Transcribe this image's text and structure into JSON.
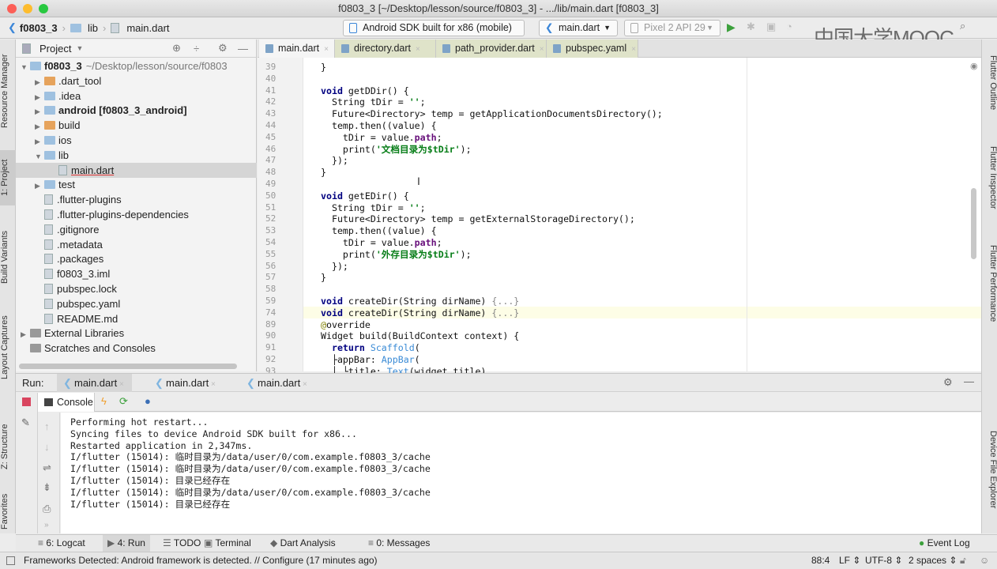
{
  "window": {
    "title": "f0803_3 [~/Desktop/lesson/source/f0803_3] - .../lib/main.dart [f0803_3]"
  },
  "breadcrumb": [
    "f0803_3",
    "lib",
    "main.dart"
  ],
  "toolbar": {
    "device": "Android SDK built for x86 (mobile)",
    "run_config": "main.dart",
    "emulator": "Pixel 2 API 29"
  },
  "watermark": "中国大学MOOC",
  "left_strip": [
    "Resource Manager",
    "1: Project",
    "Build Variants",
    "Layout Captures",
    "Z: Structure",
    "Favorites"
  ],
  "right_strip": [
    "Flutter Outline",
    "Flutter Inspector",
    "Flutter Performance",
    "Device File Explorer"
  ],
  "project": {
    "title": "Project",
    "tree": [
      {
        "label": "f0803_3",
        "suffix": "~/Desktop/lesson/source/f0803",
        "indent": 0,
        "type": "folder",
        "expanded": true,
        "bold": true
      },
      {
        "label": ".dart_tool",
        "indent": 1,
        "type": "folder-orange",
        "expanded": false
      },
      {
        "label": ".idea",
        "indent": 1,
        "type": "folder",
        "expanded": false
      },
      {
        "label": "android [f0803_3_android]",
        "indent": 1,
        "type": "folder",
        "expanded": false,
        "bold": true
      },
      {
        "label": "build",
        "indent": 1,
        "type": "folder-orange",
        "expanded": false
      },
      {
        "label": "ios",
        "indent": 1,
        "type": "folder",
        "expanded": false
      },
      {
        "label": "lib",
        "indent": 1,
        "type": "folder",
        "expanded": true
      },
      {
        "label": "main.dart",
        "indent": 2,
        "type": "file",
        "selected": true
      },
      {
        "label": "test",
        "indent": 1,
        "type": "folder",
        "expanded": false
      },
      {
        "label": ".flutter-plugins",
        "indent": 1,
        "type": "file"
      },
      {
        "label": ".flutter-plugins-dependencies",
        "indent": 1,
        "type": "file"
      },
      {
        "label": ".gitignore",
        "indent": 1,
        "type": "file"
      },
      {
        "label": ".metadata",
        "indent": 1,
        "type": "file"
      },
      {
        "label": ".packages",
        "indent": 1,
        "type": "file"
      },
      {
        "label": "f0803_3.iml",
        "indent": 1,
        "type": "file"
      },
      {
        "label": "pubspec.lock",
        "indent": 1,
        "type": "file"
      },
      {
        "label": "pubspec.yaml",
        "indent": 1,
        "type": "file"
      },
      {
        "label": "README.md",
        "indent": 1,
        "type": "file"
      },
      {
        "label": "External Libraries",
        "indent": 0,
        "type": "lib",
        "expanded": false
      },
      {
        "label": "Scratches and Consoles",
        "indent": 0,
        "type": "scratch"
      }
    ]
  },
  "editor": {
    "tabs": [
      {
        "label": "main.dart",
        "active": true
      },
      {
        "label": "directory.dart"
      },
      {
        "label": "path_provider.dart"
      },
      {
        "label": "pubspec.yaml"
      }
    ],
    "lines": [
      {
        "n": "39",
        "seg": [
          [
            "}",
            ""
          ]
        ]
      },
      {
        "n": "40",
        "seg": []
      },
      {
        "n": "41",
        "seg": [
          [
            "void",
            "kw"
          ],
          [
            " getDDir() {",
            ""
          ]
        ]
      },
      {
        "n": "42",
        "seg": [
          [
            "  String tDir = ",
            ""
          ],
          [
            "''",
            "str"
          ],
          [
            ";",
            ""
          ]
        ]
      },
      {
        "n": "43",
        "seg": [
          [
            "  Future<Directory> temp = getApplicationDocumentsDirectory();",
            ""
          ]
        ]
      },
      {
        "n": "44",
        "seg": [
          [
            "  temp.then((value) {",
            ""
          ]
        ]
      },
      {
        "n": "45",
        "seg": [
          [
            "    tDir = value.",
            ""
          ],
          [
            "path",
            "fld"
          ],
          [
            ";",
            ""
          ]
        ]
      },
      {
        "n": "46",
        "seg": [
          [
            "    print(",
            ""
          ],
          [
            "'文档目录为$tDir'",
            "str"
          ],
          [
            ");",
            ""
          ]
        ]
      },
      {
        "n": "47",
        "seg": [
          [
            "  });",
            ""
          ]
        ]
      },
      {
        "n": "48",
        "seg": [
          [
            "}",
            ""
          ]
        ]
      },
      {
        "n": "49",
        "seg": []
      },
      {
        "n": "50",
        "seg": [
          [
            "void",
            "kw"
          ],
          [
            " getEDir() {",
            ""
          ]
        ]
      },
      {
        "n": "51",
        "seg": [
          [
            "  String tDir = ",
            ""
          ],
          [
            "''",
            "str"
          ],
          [
            ";",
            ""
          ]
        ]
      },
      {
        "n": "52",
        "seg": [
          [
            "  Future<Directory> temp = getExternalStorageDirectory();",
            ""
          ]
        ]
      },
      {
        "n": "53",
        "seg": [
          [
            "  temp.then((value) {",
            ""
          ]
        ]
      },
      {
        "n": "54",
        "seg": [
          [
            "    tDir = value.",
            ""
          ],
          [
            "path",
            "fld"
          ],
          [
            ";",
            ""
          ]
        ]
      },
      {
        "n": "55",
        "seg": [
          [
            "    print(",
            ""
          ],
          [
            "'外存目录为$tDir'",
            "str"
          ],
          [
            ");",
            ""
          ]
        ]
      },
      {
        "n": "56",
        "seg": [
          [
            "  });",
            ""
          ]
        ]
      },
      {
        "n": "57",
        "seg": [
          [
            "}",
            ""
          ]
        ]
      },
      {
        "n": "58",
        "seg": []
      },
      {
        "n": "59",
        "seg": [
          [
            "void",
            "kw"
          ],
          [
            " createDir(String dirName) ",
            ""
          ],
          [
            "{...}",
            "fold"
          ]
        ]
      },
      {
        "n": "74",
        "seg": [
          [
            "void",
            "kw"
          ],
          [
            " createDir(String dirName) ",
            ""
          ],
          [
            "{...}",
            "fold"
          ]
        ]
      },
      {
        "n": "89",
        "seg": [
          [
            "@",
            "ann"
          ],
          [
            "override",
            ""
          ]
        ]
      },
      {
        "n": "90",
        "seg": [
          [
            "Widget build(BuildContext context) {",
            ""
          ]
        ]
      },
      {
        "n": "91",
        "seg": [
          [
            "  ",
            ""
          ],
          [
            "return",
            "kw"
          ],
          [
            " ",
            ""
          ],
          [
            "Scaffold",
            "cls"
          ],
          [
            "(",
            ""
          ]
        ]
      },
      {
        "n": "92",
        "seg": [
          [
            "  ├appBar: ",
            ""
          ],
          [
            "AppBar",
            "cls"
          ],
          [
            "(",
            ""
          ]
        ]
      },
      {
        "n": "93",
        "seg": [
          [
            "  │ └title: ",
            ""
          ],
          [
            "Text",
            "cls"
          ],
          [
            "(widget.title),",
            ""
          ]
        ]
      }
    ]
  },
  "run": {
    "label": "Run:",
    "tabs": [
      "main.dart",
      "main.dart",
      "main.dart"
    ],
    "console_tab": "Console",
    "output": [
      "Performing hot restart...",
      "Syncing files to device Android SDK built for x86...",
      "Restarted application in 2,347ms.",
      "I/flutter (15014): 临时目录为/data/user/0/com.example.f0803_3/cache",
      "I/flutter (15014): 临时目录为/data/user/0/com.example.f0803_3/cache",
      "I/flutter (15014): 目录已经存在",
      "I/flutter (15014): 临时目录为/data/user/0/com.example.f0803_3/cache",
      "I/flutter (15014): 目录已经存在"
    ]
  },
  "bottom_tabs": [
    "6: Logcat",
    "4: Run",
    "TODO",
    "Terminal",
    "Dart Analysis",
    "0: Messages"
  ],
  "event_log": "Event Log",
  "status": {
    "message": "Frameworks Detected: Android framework is detected. // Configure (17 minutes ago)",
    "position": "88:4",
    "line_sep": "LF",
    "encoding": "UTF-8",
    "indent": "2 spaces"
  }
}
